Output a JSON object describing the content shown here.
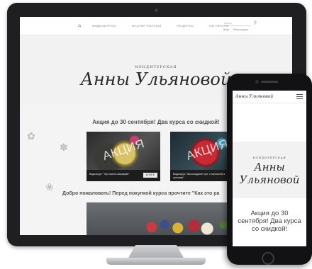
{
  "desktop": {
    "nav": {
      "home_icon": "home-icon",
      "items": [
        "ВИДЕОКУРСЫ",
        "МАСТЕР-КЛАССЫ",
        "РЕЦЕПТЫ",
        "ОБ АВТОРЕ"
      ],
      "search_placeholder": "Поиск",
      "links": [
        "Вход",
        "Регистрация"
      ]
    },
    "logo": {
      "top": "КОНДИТЕРСКАЯ",
      "main": "Анны Ульяновой"
    },
    "promo_title": "Акция до 30 сентября! Два курса со скидкой!",
    "cards": [
      {
        "watermark": "АКЦИЯ",
        "caption": "Видеокурс \"Торт манго-маракуйя\"",
        "button": "БОЛЕЕ"
      },
      {
        "watermark": "АКЦИЯ",
        "caption": "Видеокурс \"Шоколадный торт с черешней и орехами\"",
        "button": "БОЛЕЕ"
      }
    ],
    "welcome": "Добро пожаловать! Перед покупкой курса прочтите \"Как это ра"
  },
  "phone": {
    "logo_small": "Анны Ульяновой",
    "logo": {
      "top": "КОНДИТЕРСКАЯ",
      "main": "Анны Ульяновой"
    },
    "promo": "Акция до 30 сентября! Два курса со скидкой!"
  },
  "colors": {
    "bezel": "#1f1f22",
    "page_bg": "#f4f4f4",
    "text_dark": "#2b2b2b"
  }
}
